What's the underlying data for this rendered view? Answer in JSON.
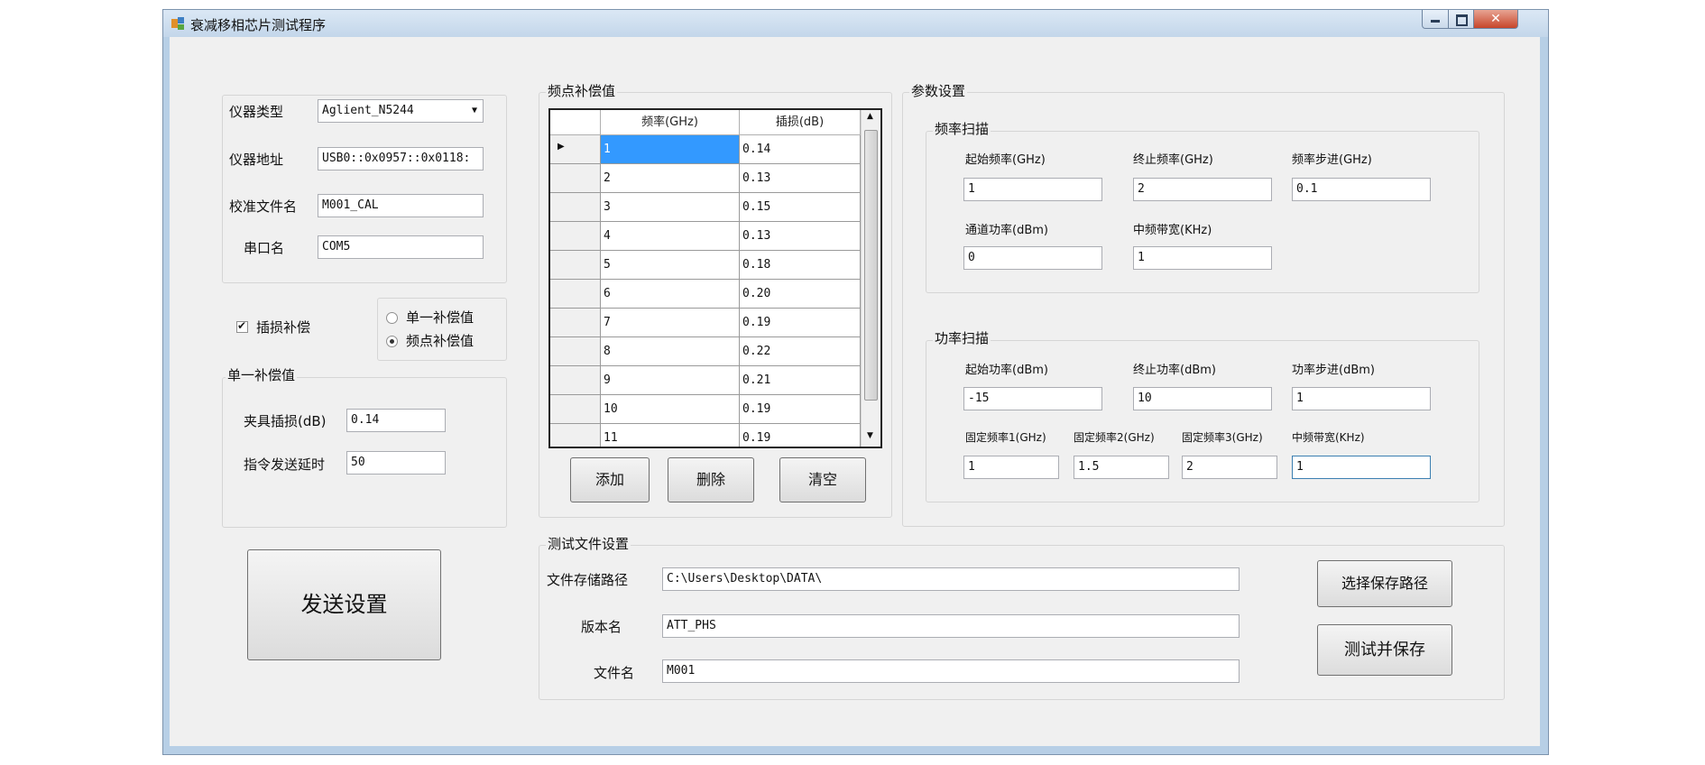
{
  "window": {
    "title": "衰减移相芯片测试程序"
  },
  "instrument": {
    "type_label": "仪器类型",
    "type_value": "Aglient_N5244",
    "address_label": "仪器地址",
    "address_value": "USB0::0x0957::0x0118:",
    "calfile_label": "校准文件名",
    "calfile_value": "M001_CAL",
    "serial_label": "串口名",
    "serial_value": "COM5"
  },
  "compensation": {
    "insertion_loss_check_label": "插损补偿",
    "insertion_loss_checked": true,
    "single_radio_label": "单一补偿值",
    "freq_radio_label": "频点补偿值",
    "selected": "频点补偿值"
  },
  "single_comp": {
    "group_title": "单一补偿值",
    "fixture_loss_label": "夹具插损(dB)",
    "fixture_loss_value": "0.14",
    "cmd_delay_label": "指令发送延时",
    "cmd_delay_value": "50"
  },
  "send_button_label": "发送设置",
  "freq_comp": {
    "group_title": "频点补偿值",
    "columns": [
      "频率(GHz)",
      "插损(dB)"
    ],
    "rows": [
      [
        "1",
        "0.14"
      ],
      [
        "2",
        "0.13"
      ],
      [
        "3",
        "0.15"
      ],
      [
        "4",
        "0.13"
      ],
      [
        "5",
        "0.18"
      ],
      [
        "6",
        "0.20"
      ],
      [
        "7",
        "0.19"
      ],
      [
        "8",
        "0.22"
      ],
      [
        "9",
        "0.21"
      ],
      [
        "10",
        "0.19"
      ],
      [
        "11",
        "0.19"
      ]
    ],
    "add_label": "添加",
    "delete_label": "删除",
    "clear_label": "清空"
  },
  "params": {
    "group_title": "参数设置",
    "freq_sweep": {
      "title": "频率扫描",
      "start_label": "起始频率(GHz)",
      "start_value": "1",
      "stop_label": "终止频率(GHz)",
      "stop_value": "2",
      "step_label": "频率步进(GHz)",
      "step_value": "0.1",
      "power_label": "通道功率(dBm)",
      "power_value": "0",
      "ifbw_label": "中频带宽(KHz)",
      "ifbw_value": "1"
    },
    "power_sweep": {
      "title": "功率扫描",
      "start_label": "起始功率(dBm)",
      "start_value": "-15",
      "stop_label": "终止功率(dBm)",
      "stop_value": "10",
      "step_label": "功率步进(dBm)",
      "step_value": "1",
      "fixed1_label": "固定频率1(GHz)",
      "fixed1_value": "1",
      "fixed2_label": "固定频率2(GHz)",
      "fixed2_value": "1.5",
      "fixed3_label": "固定频率3(GHz)",
      "fixed3_value": "2",
      "ifbw_label": "中频带宽(KHz)",
      "ifbw_value": "1"
    }
  },
  "test_file": {
    "group_title": "测试文件设置",
    "path_label": "文件存储路径",
    "path_value": "C:\\Users\\Desktop\\DATA\\",
    "version_label": "版本名",
    "version_value": "ATT_PHS",
    "filename_label": "文件名",
    "filename_value": "M001",
    "choose_path_label": "选择保存路径",
    "test_save_label": "测试并保存"
  }
}
